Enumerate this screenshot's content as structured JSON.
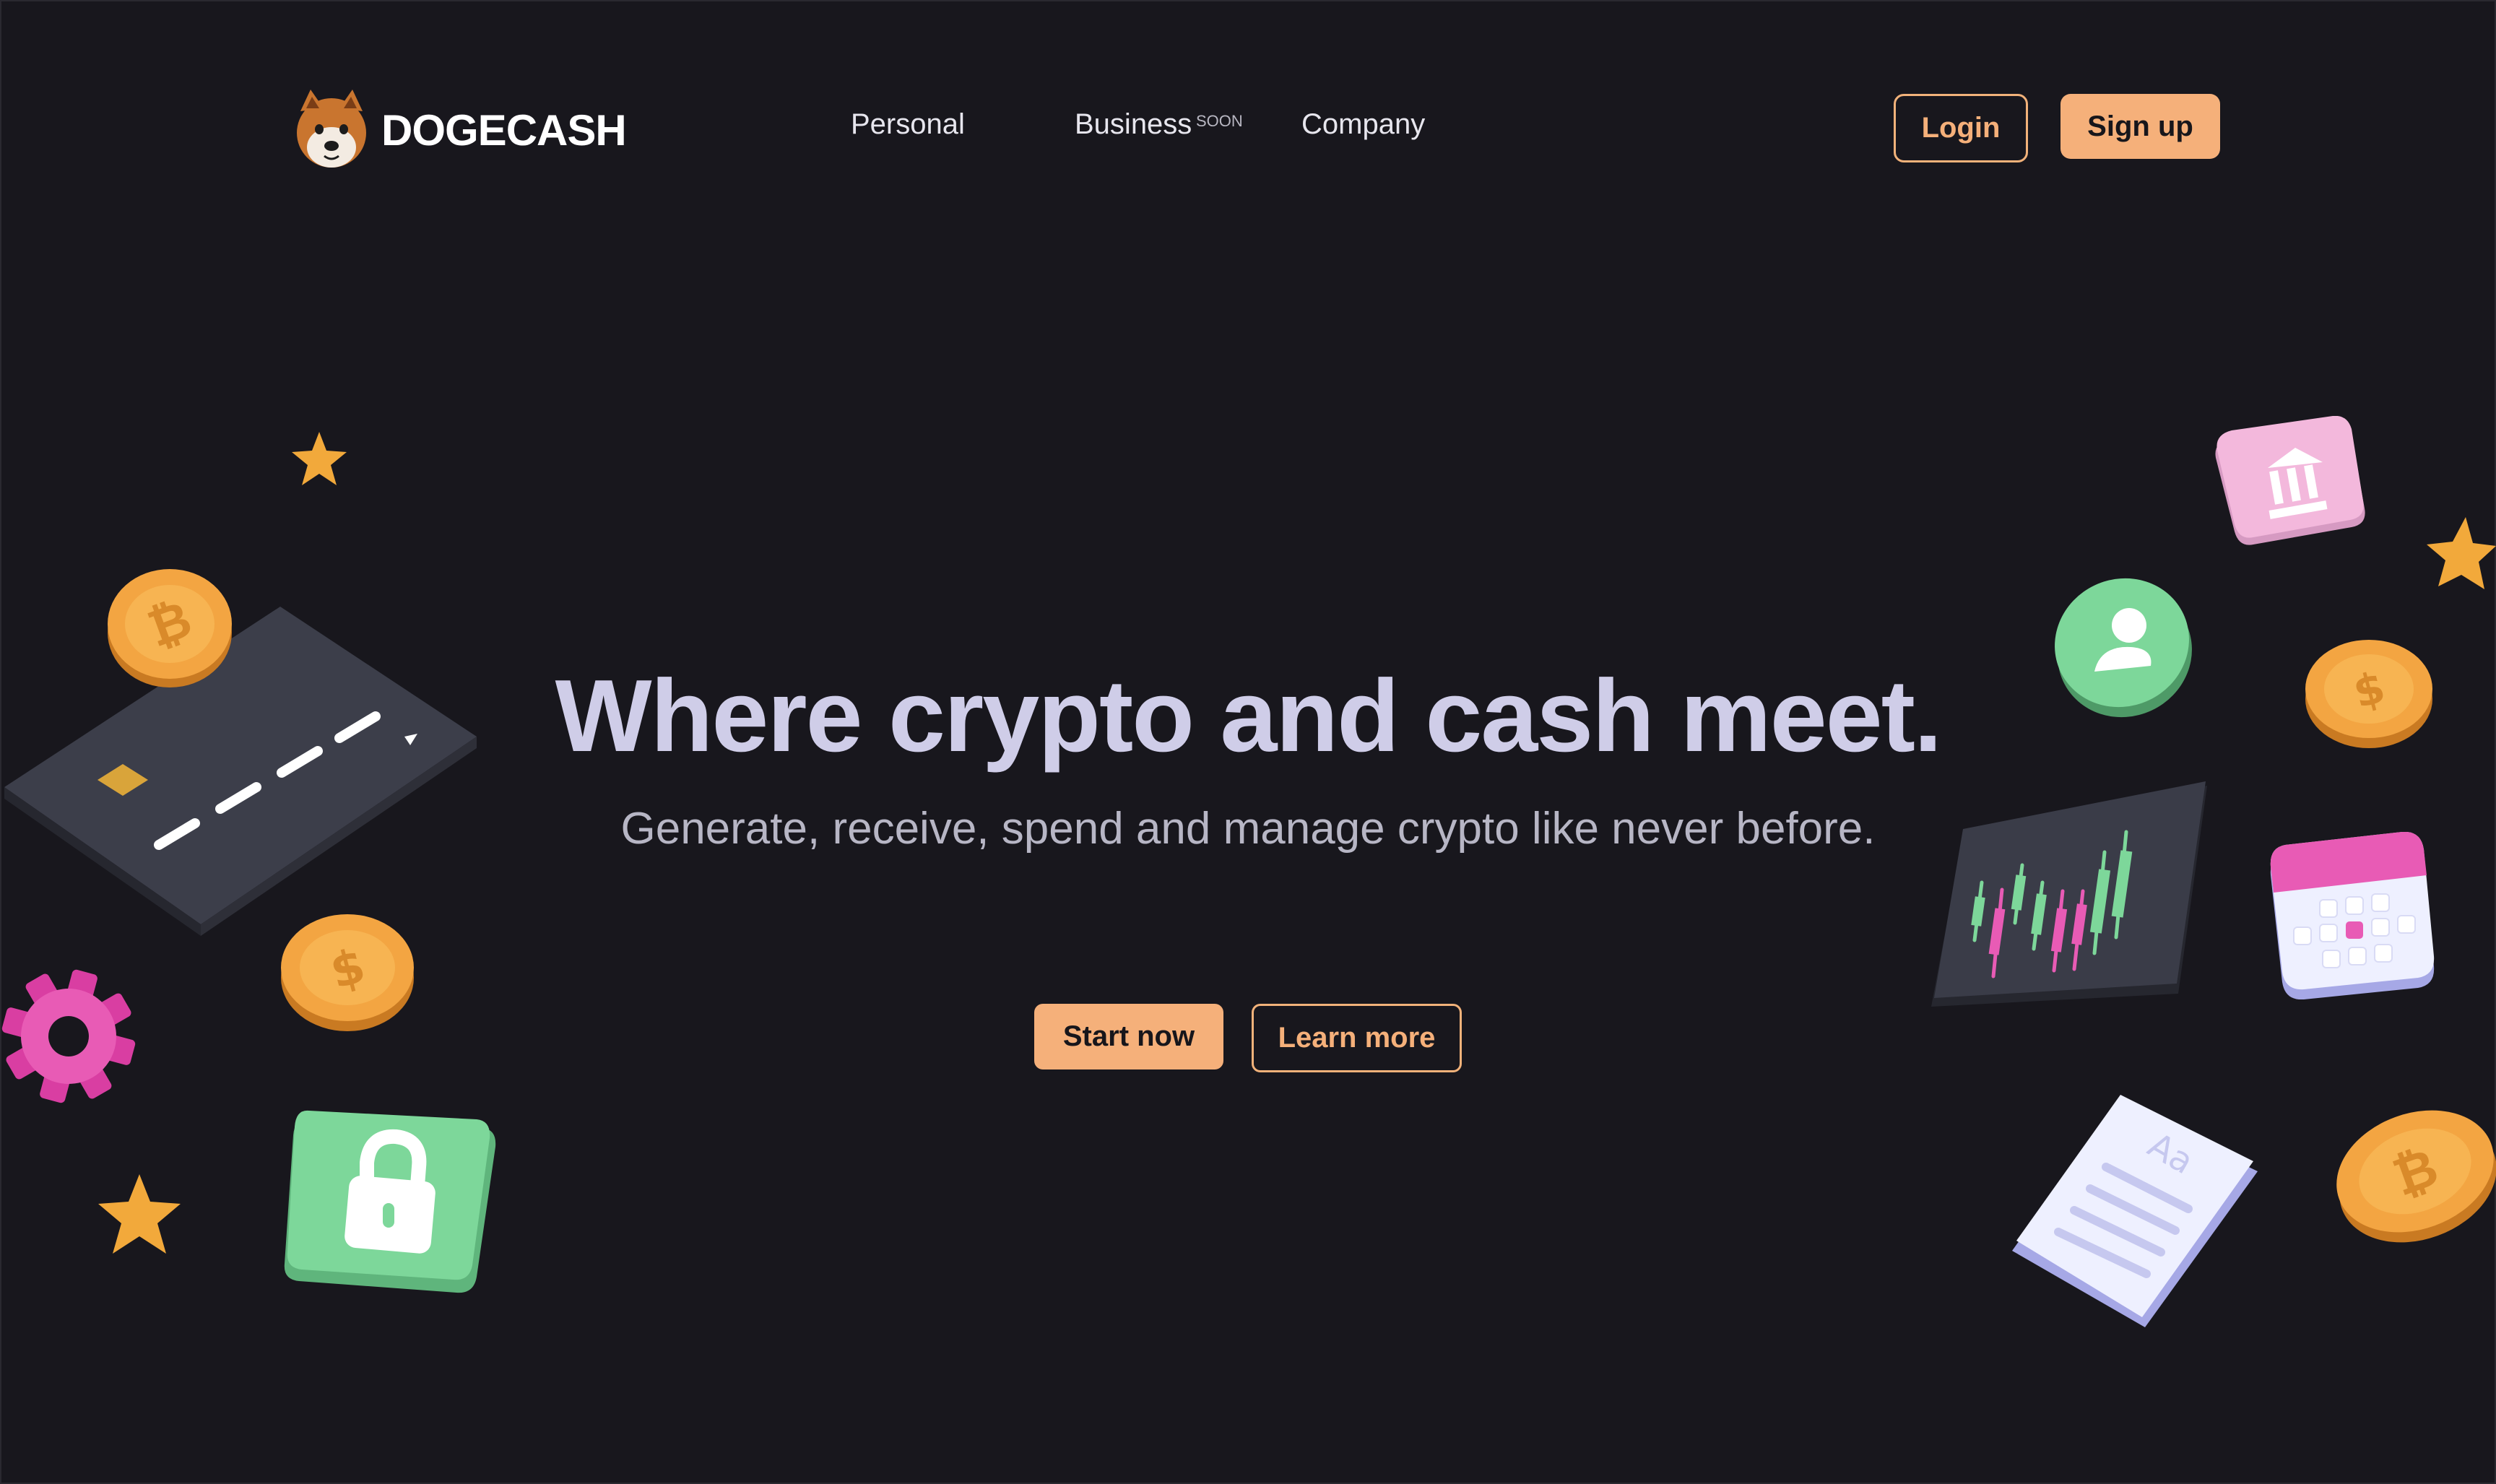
{
  "brand": {
    "name": "DOGECASH"
  },
  "nav": {
    "links": [
      {
        "label": "Personal"
      },
      {
        "label": "Business",
        "badge": "SOON"
      },
      {
        "label": "Company"
      }
    ],
    "login_label": "Login",
    "signup_label": "Sign up"
  },
  "hero": {
    "headline": "Where crypto and cash meet.",
    "subheadline": "Generate, receive, spend and manage crypto like never before.",
    "primary_cta": "Start now",
    "secondary_cta": "Learn more"
  },
  "decorations": {
    "left": [
      "star-icon",
      "bitcoin-coin-icon",
      "credit-card-icon",
      "dollar-coin-icon",
      "gear-icon",
      "star-icon",
      "lock-icon"
    ],
    "right": [
      "bank-icon",
      "star-icon",
      "user-icon",
      "dollar-coin-icon",
      "candlestick-chart-icon",
      "calendar-icon",
      "document-icon",
      "bitcoin-coin-icon"
    ]
  },
  "colors": {
    "background": "#18171d",
    "accent": "#f5b07a",
    "headline": "#cfcde8",
    "green": "#7dd79a",
    "pink": "#e85bb5"
  }
}
